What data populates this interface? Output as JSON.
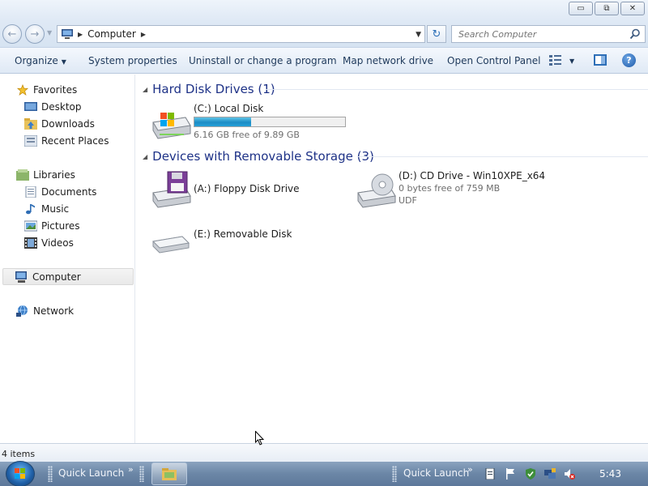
{
  "window": {
    "controls": {
      "minimize": "▭",
      "maximize": "⧉",
      "close": "✕"
    }
  },
  "address": {
    "back_icon": "←",
    "forward_icon": "→",
    "crumb": "Computer",
    "refresh_icon": "↻",
    "search_placeholder": "Search Computer"
  },
  "toolbar": {
    "organize": "Organize",
    "system_properties": "System properties",
    "uninstall": "Uninstall or change a program",
    "map_drive": "Map network drive",
    "control_panel": "Open Control Panel",
    "help": "?"
  },
  "nav": {
    "favorites": "Favorites",
    "desktop": "Desktop",
    "downloads": "Downloads",
    "recent_places": "Recent Places",
    "libraries": "Libraries",
    "documents": "Documents",
    "music": "Music",
    "pictures": "Pictures",
    "videos": "Videos",
    "computer": "Computer",
    "network": "Network"
  },
  "groups": {
    "hard_disks": "Hard Disk Drives (1)",
    "removable": "Devices with Removable Storage (3)"
  },
  "drives": {
    "c": {
      "name": "(C:) Local Disk",
      "free": "6.16 GB free of 9.89 GB",
      "used_fraction": 0.377
    },
    "a": {
      "name": "(A:) Floppy Disk Drive"
    },
    "d": {
      "name": "(D:) CD Drive - Win10XPE_x64",
      "free": "0 bytes free of 759 MB",
      "fs": "UDF"
    },
    "e": {
      "name": "(E:) Removable Disk"
    }
  },
  "status": {
    "items": "4 items"
  },
  "taskbar": {
    "quick_launch_1": "Quick Launch",
    "quick_launch_2": "Quick Launch",
    "chevron": "»",
    "time": "5:43"
  }
}
